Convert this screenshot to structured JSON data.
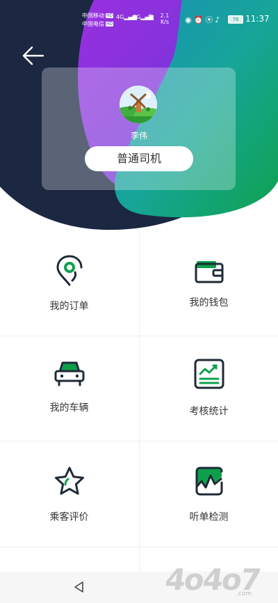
{
  "status_bar": {
    "carrier_1": "中国移动",
    "carrier_2": "中国电信",
    "hd": "HD",
    "signal_1": "4G",
    "signal_2": "4G",
    "speed_value": "2.1",
    "speed_unit": "K/s",
    "icons": [
      "eye-icon",
      "alarm-icon",
      "location-icon",
      "mute-icon"
    ],
    "battery": "76",
    "time": "11:37"
  },
  "profile": {
    "name": "李伟",
    "role": "普通司机"
  },
  "menu": {
    "items": [
      {
        "label": "我的订单",
        "icon": "order-pin-icon"
      },
      {
        "label": "我的钱包",
        "icon": "wallet-icon"
      },
      {
        "label": "我的车辆",
        "icon": "car-icon"
      },
      {
        "label": "考核统计",
        "icon": "stats-chart-icon"
      },
      {
        "label": "乘客评价",
        "icon": "star-icon"
      },
      {
        "label": "听单检测",
        "icon": "signal-check-icon"
      }
    ]
  },
  "watermark": {
    "text": "4o4o7",
    "url": ".com"
  },
  "colors": {
    "navy": "#1c2742",
    "purple": "#7a2fd6",
    "teal": "#1aa596",
    "green": "#0e9f4c",
    "icon_dark": "#1f2a36"
  }
}
